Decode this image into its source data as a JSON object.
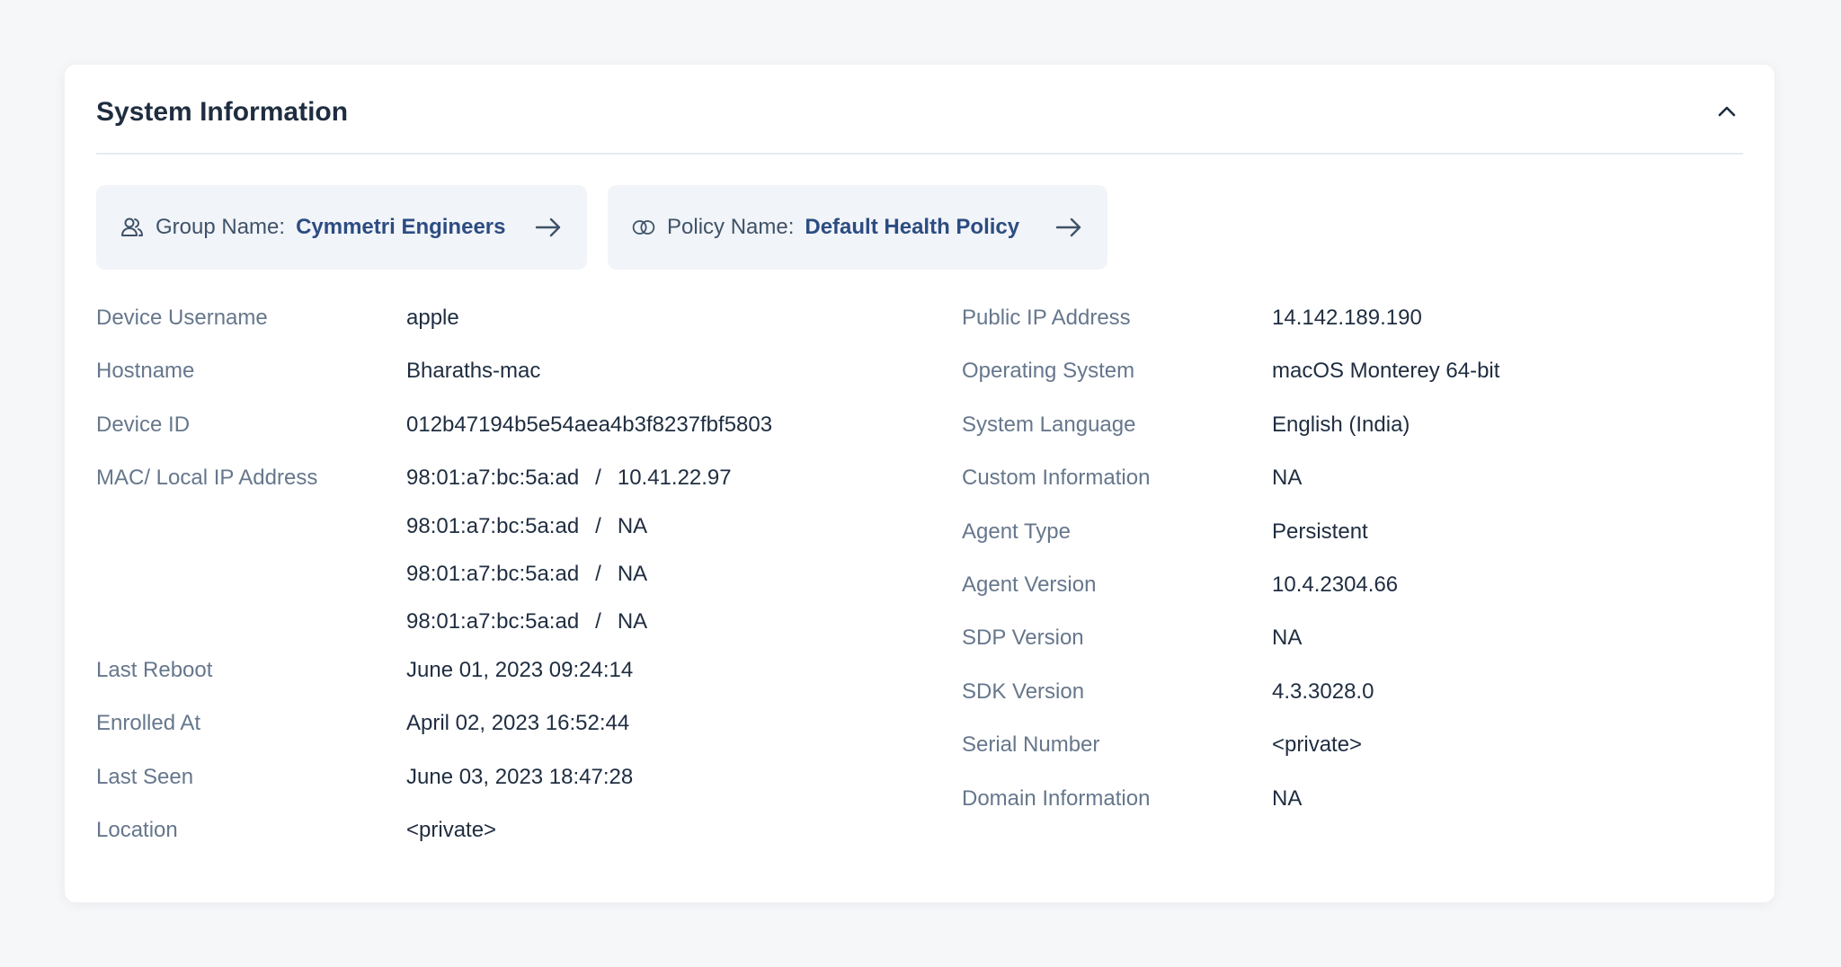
{
  "card": {
    "title": "System Information"
  },
  "chips": {
    "group": {
      "label": "Group Name:",
      "value": "Cymmetri Engineers"
    },
    "policy": {
      "label": "Policy Name:",
      "value": "Default Health Policy"
    }
  },
  "left": {
    "device_username": {
      "label": "Device Username",
      "value": "apple"
    },
    "hostname": {
      "label": "Hostname",
      "value": "Bharaths-mac"
    },
    "device_id": {
      "label": "Device ID",
      "value": "012b47194b5e54aea4b3f8237fbf5803"
    },
    "mac": {
      "label": "MAC/ Local IP Address",
      "separator": "/",
      "entries": [
        {
          "mac": "98:01:a7:bc:5a:ad",
          "ip": "10.41.22.97"
        },
        {
          "mac": "98:01:a7:bc:5a:ad",
          "ip": "NA"
        },
        {
          "mac": "98:01:a7:bc:5a:ad",
          "ip": "NA"
        },
        {
          "mac": "98:01:a7:bc:5a:ad",
          "ip": "NA"
        }
      ]
    },
    "last_reboot": {
      "label": "Last Reboot",
      "value": "June 01, 2023 09:24:14"
    },
    "enrolled_at": {
      "label": "Enrolled At",
      "value": "April 02, 2023 16:52:44"
    },
    "last_seen": {
      "label": "Last Seen",
      "value": "June 03, 2023 18:47:28"
    },
    "location": {
      "label": "Location",
      "value": "<private>"
    }
  },
  "right": [
    {
      "label": "Public IP Address",
      "value": "14.142.189.190"
    },
    {
      "label": "Operating System",
      "value": "macOS Monterey 64-bit"
    },
    {
      "label": "System Language",
      "value": "English (India)"
    },
    {
      "label": "Custom Information",
      "value": "NA"
    },
    {
      "label": "Agent Type",
      "value": "Persistent"
    },
    {
      "label": "Agent Version",
      "value": "10.4.2304.66"
    },
    {
      "label": "SDP Version",
      "value": "NA"
    },
    {
      "label": "SDK Version",
      "value": "4.3.3028.0"
    },
    {
      "label": "Serial Number",
      "value": "<private>"
    },
    {
      "label": "Domain Information",
      "value": "NA"
    }
  ],
  "icons": {
    "collapse": "chevron-up-icon",
    "group": "users-icon",
    "policy": "policy-rings-icon",
    "arrow": "arrow-right-icon"
  },
  "colors": {
    "accent": "#2c4c82",
    "label": "#66778c",
    "value": "#1f2d40",
    "chip_bg": "#f1f4f8"
  }
}
